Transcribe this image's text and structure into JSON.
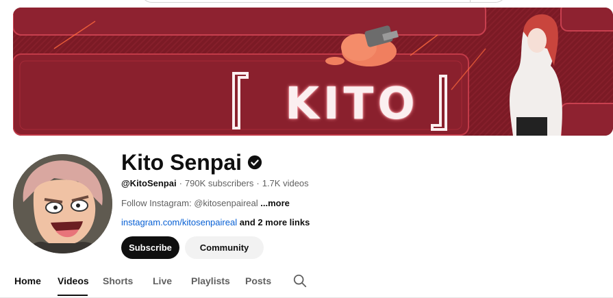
{
  "banner": {
    "title": "KITO",
    "bracket_open": "「",
    "bracket_close": "」"
  },
  "channel": {
    "name": "Kito Senpai",
    "handle": "@KitoSenpai",
    "separator": "·",
    "subscribers": "790K subscribers",
    "videos": "1.7K videos",
    "description": "Follow Instagram: @kitosenpaireal",
    "more_label": "...more",
    "link": "instagram.com/kitosenpaireal",
    "more_links": "and 2 more links"
  },
  "buttons": {
    "subscribe": "Subscribe",
    "community": "Community"
  },
  "tabs": [
    "Home",
    "Videos",
    "Shorts",
    "Live",
    "Playlists",
    "Posts"
  ],
  "colors": {
    "banner_bg": "#7e1c26",
    "link": "#065fd4",
    "subscribe_bg": "#0f0f0f"
  },
  "icons": {
    "verified": "verified-check-icon",
    "tab_search": "search-icon"
  }
}
